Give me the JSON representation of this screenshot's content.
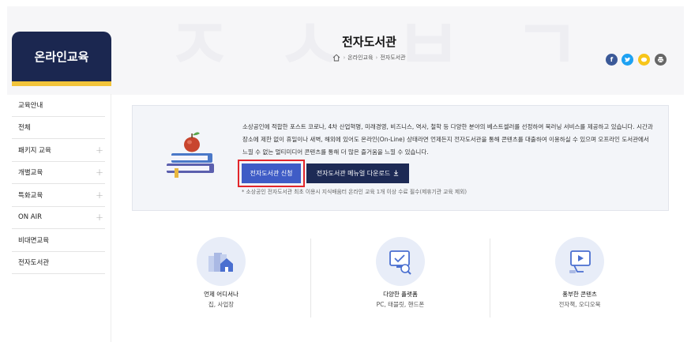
{
  "hero": {
    "title": "전자도서관",
    "breadcrumb": [
      "온라인교육",
      "전자도서관"
    ]
  },
  "sidebar": {
    "title": "온라인교육",
    "items": [
      {
        "label": "교육안내",
        "expandable": false
      },
      {
        "label": "전체",
        "expandable": false
      },
      {
        "label": "패키지 교육",
        "expandable": true
      },
      {
        "label": "개별교육",
        "expandable": true
      },
      {
        "label": "특화교육",
        "expandable": true
      },
      {
        "label": "ON AIR",
        "expandable": true
      },
      {
        "label": "비대면교육",
        "expandable": false
      },
      {
        "label": "전자도서관",
        "expandable": false
      }
    ]
  },
  "social": [
    {
      "icon": "facebook-icon",
      "glyph": "f",
      "color": "#3b5998"
    },
    {
      "icon": "twitter-icon",
      "glyph": "t",
      "color": "#1da1f2"
    },
    {
      "icon": "kakao-icon",
      "glyph": "…",
      "color": "#f7c51a"
    },
    {
      "icon": "print-icon",
      "glyph": "⎙",
      "color": "#666666"
    }
  ],
  "intro": {
    "text": "소상공인에 적합한 포스트 코로나, 4차 산업혁명, 미래경영, 비즈니스, 역사, 철학 등 다양한 분야의 베스트셀러를 선정하여 북러닝 서비스를 제공하고 있습니다. 시간과 장소에 제한 없이 휴일이나 새벽, 해외에 있어도 온라인(On-Line) 상태라면 언제든지 전자도서관을 통해 콘텐츠를 대출하여 이용하실 수 있으며 오프라인 도서관에서 느낄 수 없는 멀티미디어 콘텐츠를 통해 더 많은 즐거움을 느낄 수 있습니다.",
    "apply_label": "전자도서관 신청",
    "manual_label": "전자도서관 메뉴얼 다운로드",
    "note": "* 소상공인 전자도서관 최초 이용시 지식배움터 온라인 교육 1개 이상 수료 필수(제휴기관 교육 제외)"
  },
  "features": [
    {
      "title": "언제 어디서나",
      "subtitle": "집, 사업장"
    },
    {
      "title": "다양한 플랫폼",
      "subtitle": "PC, 태블릿, 핸드폰"
    },
    {
      "title": "풍부한 콘텐츠",
      "subtitle": "전자책, 오디오북"
    }
  ],
  "colors": {
    "sidebar_header": "#1b2750",
    "accent_tab": "#f2c43a",
    "apply_button": "#3f5cc6",
    "manual_button": "#1d2a55",
    "highlight": "#e2262b"
  }
}
